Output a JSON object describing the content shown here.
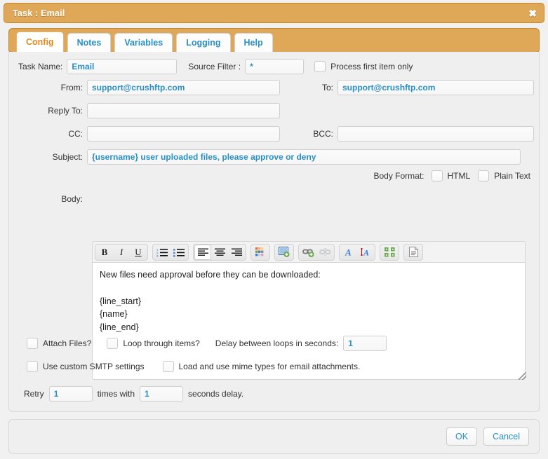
{
  "window": {
    "title": "Task : Email",
    "close_icon": "close-icon"
  },
  "tabs": [
    {
      "label": "Config",
      "active": true
    },
    {
      "label": "Notes",
      "active": false
    },
    {
      "label": "Variables",
      "active": false
    },
    {
      "label": "Logging",
      "active": false
    },
    {
      "label": "Help",
      "active": false
    }
  ],
  "form": {
    "task_name_label": "Task Name:",
    "task_name_value": "Email",
    "source_filter_label": "Source Filter :",
    "source_filter_value": "*",
    "process_first_item_label": "Process first item only",
    "from_label": "From:",
    "from_value": "support@crushftp.com",
    "to_label": "To:",
    "to_value": "support@crushftp.com",
    "reply_to_label": "Reply To:",
    "reply_to_value": "",
    "cc_label": "CC:",
    "cc_value": "",
    "bcc_label": "BCC:",
    "bcc_value": "",
    "subject_label": "Subject:",
    "subject_value": "{username} user uploaded files, please approve or deny",
    "body_format_label": "Body Format:",
    "html_label": "HTML",
    "plain_text_label": "Plain Text",
    "body_label": "Body:",
    "body_value": "New files need approval before they can be downloaded:\n\n{line_start}\n{name}\n{line_end}"
  },
  "toolbar": {
    "bold": "B",
    "italic": "I",
    "underline": "U",
    "icons": [
      "bold-icon",
      "italic-icon",
      "underline-icon",
      "ordered-list-icon",
      "unordered-list-icon",
      "align-left-icon",
      "align-center-icon",
      "align-right-icon",
      "color-palette-icon",
      "insert-image-icon",
      "insert-link-icon",
      "remove-link-icon",
      "font-color-icon",
      "font-size-icon",
      "fullscreen-icon",
      "source-view-icon"
    ]
  },
  "options": {
    "attach_files_label": "Attach Files?",
    "loop_through_items_label": "Loop through items?",
    "delay_label": "Delay between loops in seconds:",
    "delay_value": "1",
    "custom_smtp_label": "Use custom SMTP settings",
    "mime_types_label": "Load and use mime types for email attachments.",
    "retry_prefix": "Retry",
    "retry_times_value": "1",
    "retry_middle": "times with",
    "retry_delay_value": "1",
    "retry_suffix": "seconds delay."
  },
  "footer": {
    "ok_label": "OK",
    "cancel_label": "Cancel"
  },
  "colors": {
    "title_bar": "#dfa858",
    "title_border": "#c8862c",
    "active_tab_text": "#e08a1e",
    "tab_text": "#2a8fc4",
    "input_text": "#2a8fc4",
    "panel_bg": "#efefef"
  }
}
